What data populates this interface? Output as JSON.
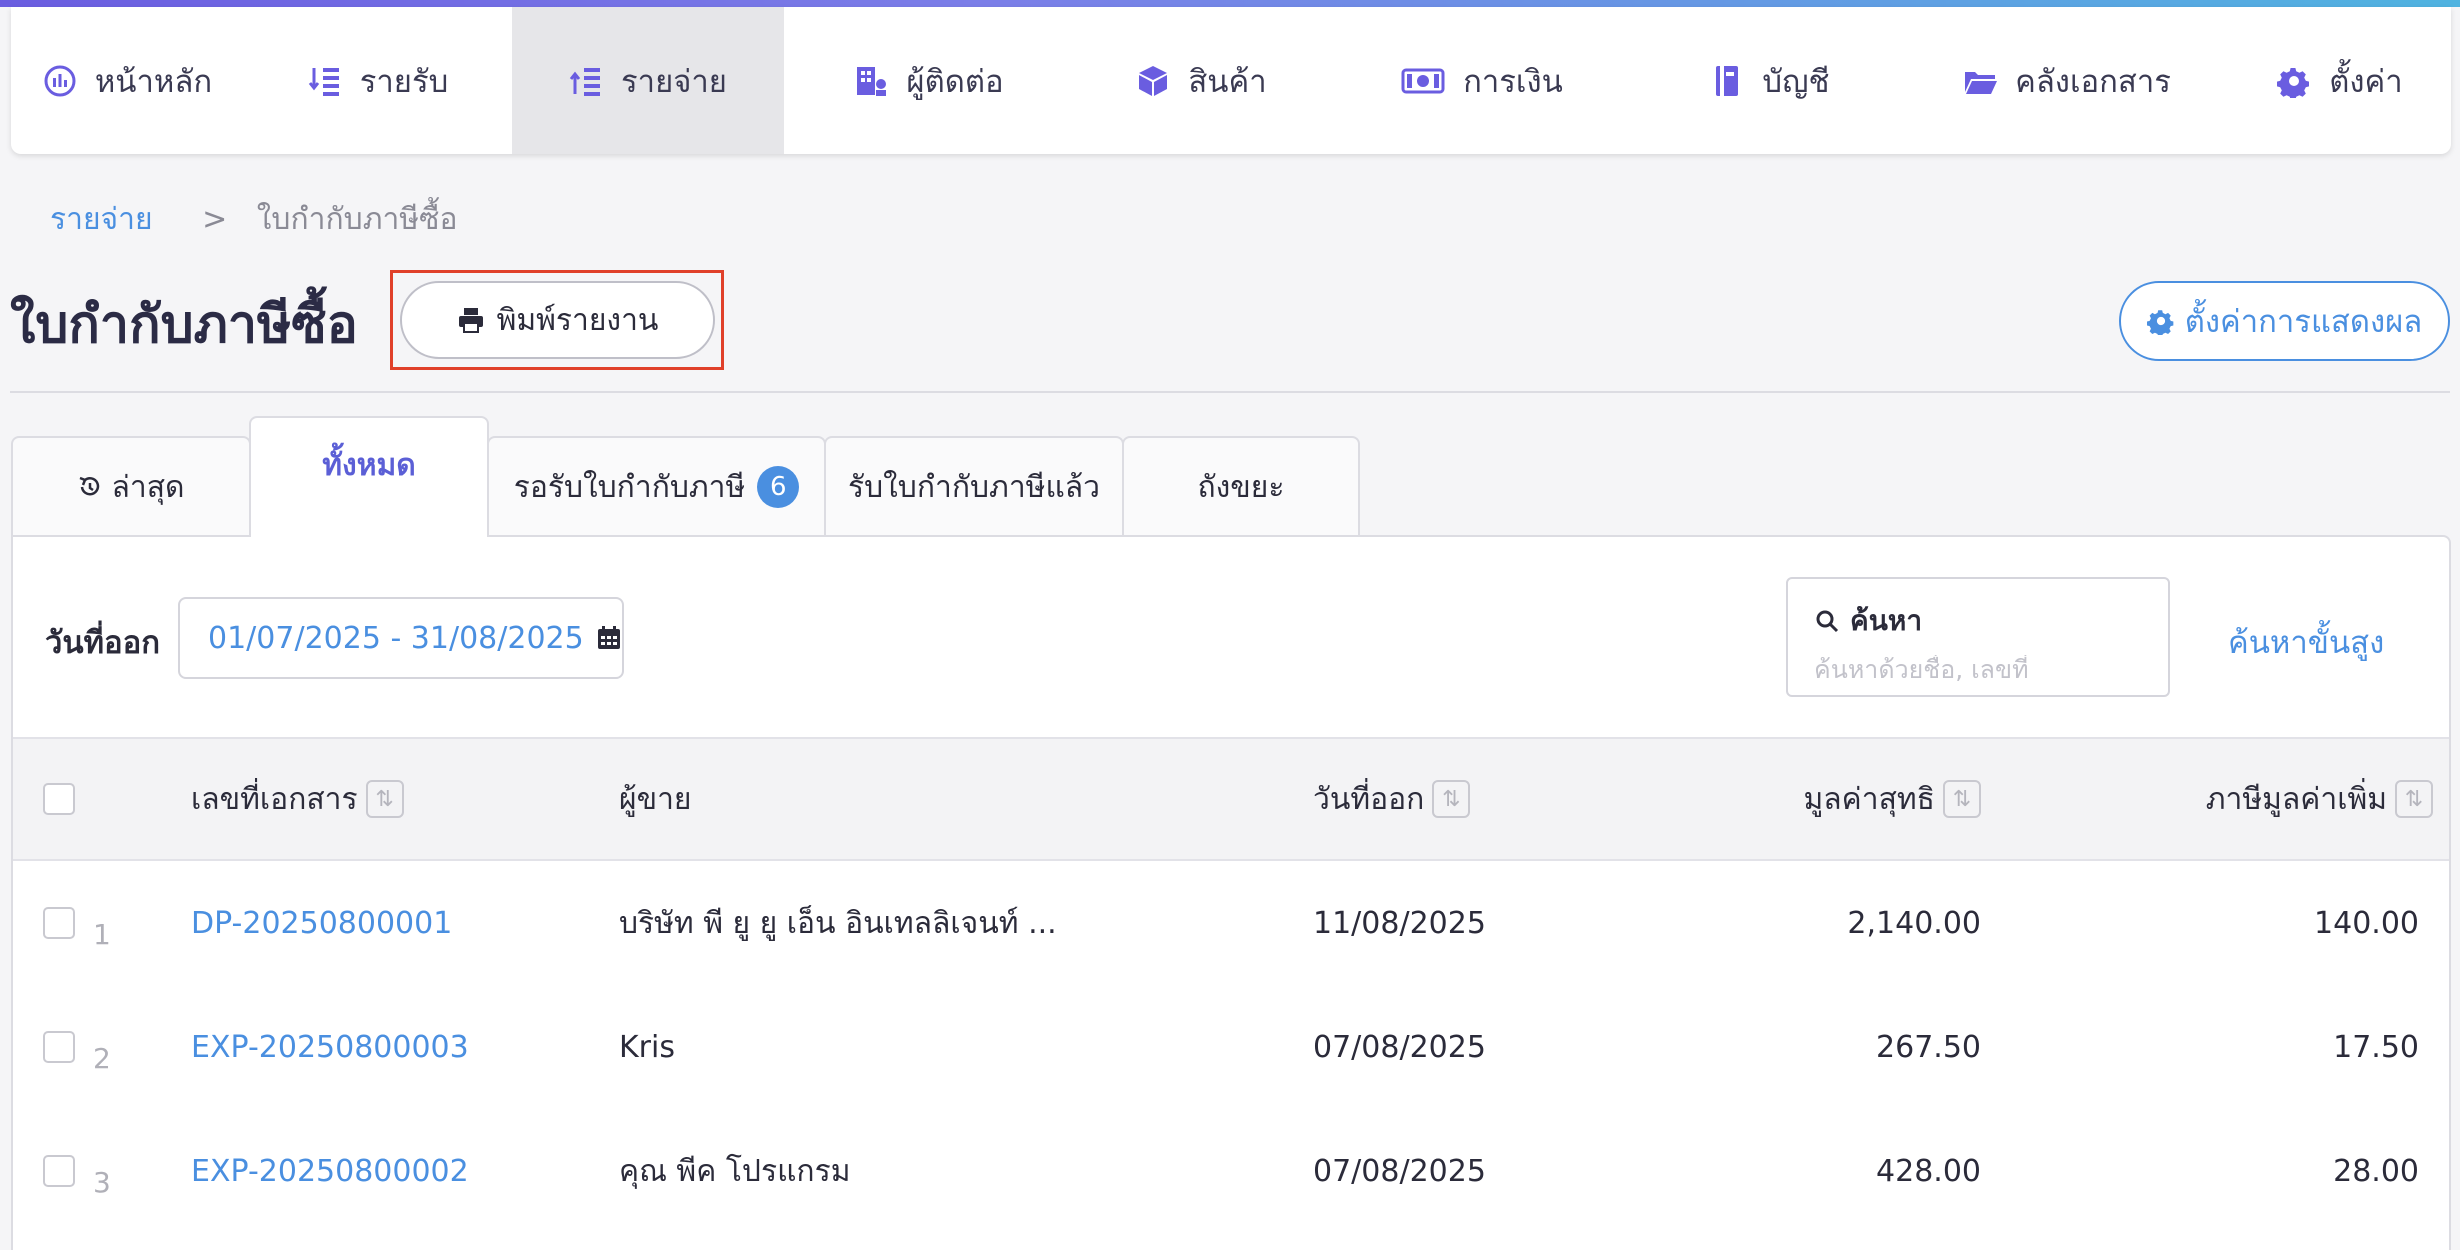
{
  "nav": {
    "items": [
      {
        "label": "หน้าหลัก",
        "icon": "dashboard-icon"
      },
      {
        "label": "รายรับ",
        "icon": "income-icon"
      },
      {
        "label": "รายจ่าย",
        "icon": "expense-icon",
        "active": true
      },
      {
        "label": "ผู้ติดต่อ",
        "icon": "contacts-icon"
      },
      {
        "label": "สินค้า",
        "icon": "box-icon"
      },
      {
        "label": "การเงิน",
        "icon": "money-icon"
      },
      {
        "label": "บัญชี",
        "icon": "ledger-icon"
      },
      {
        "label": "คลังเอกสาร",
        "icon": "folder-icon"
      },
      {
        "label": "ตั้งค่า",
        "icon": "gear-icon"
      }
    ]
  },
  "breadcrumb": {
    "parent": "รายจ่าย",
    "separator": ">",
    "current": "ใบกำกับภาษีซื้อ"
  },
  "page": {
    "title": "ใบกำกับภาษีซื้อ",
    "print_label": "พิมพ์รายงาน",
    "display_settings_label": "ตั้งค่าการแสดงผล"
  },
  "tabs": [
    {
      "label": "ล่าสุด",
      "icon": "history-icon"
    },
    {
      "label": "ทั้งหมด",
      "active": true
    },
    {
      "label": "รอรับใบกำกับภาษี",
      "badge": "6"
    },
    {
      "label": "รับใบกำกับภาษีแล้ว"
    },
    {
      "label": "ถังขยะ"
    }
  ],
  "filters": {
    "date_label": "วันที่ออก",
    "date_range": "01/07/2025 - 31/08/2025",
    "search_title": "ค้นหา",
    "search_placeholder": "ค้นหาด้วยชื่อ, เลขที่",
    "advanced_search": "ค้นหาขั้นสูง"
  },
  "table": {
    "columns": {
      "doc_no": "เลขที่เอกสาร",
      "vendor": "ผู้ขาย",
      "issue_date": "วันที่ออก",
      "net_value": "มูลค่าสุทธิ",
      "vat": "ภาษีมูลค่าเพิ่ม"
    },
    "rows": [
      {
        "num": "1",
        "doc_no": "DP-20250800001",
        "vendor": "บริษัท พี ยู ยู เอ็น อินเทลลิเจนท์ ...",
        "issue_date": "11/08/2025",
        "net_value": "2,140.00",
        "vat": "140.00"
      },
      {
        "num": "2",
        "doc_no": "EXP-20250800003",
        "vendor": "Kris",
        "issue_date": "07/08/2025",
        "net_value": "267.50",
        "vat": "17.50"
      },
      {
        "num": "3",
        "doc_no": "EXP-20250800002",
        "vendor": "คุณ พีค โปรแกรม",
        "issue_date": "07/08/2025",
        "net_value": "428.00",
        "vat": "28.00"
      }
    ]
  },
  "colors": {
    "accent": "#4a8fe0",
    "active_tab": "#5b5fd6",
    "highlight_border": "#e0402a"
  }
}
